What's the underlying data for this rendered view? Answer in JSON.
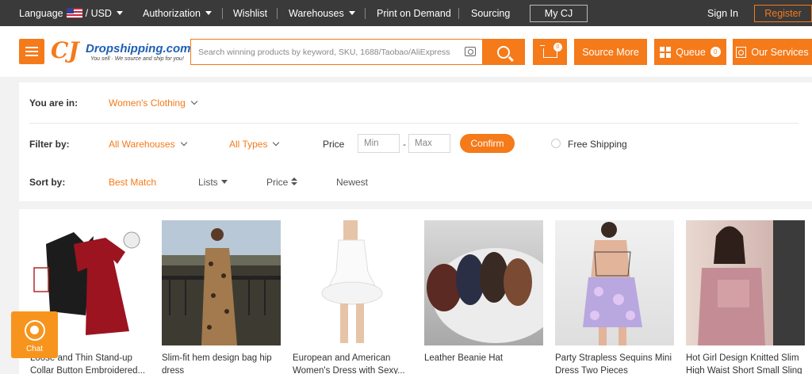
{
  "topbar": {
    "language_label": "Language",
    "currency": "/ USD",
    "authorization": "Authorization",
    "wishlist": "Wishlist",
    "warehouses": "Warehouses",
    "print_on_demand": "Print on Demand",
    "sourcing": "Sourcing",
    "my_cj": "My CJ",
    "sign_in": "Sign In",
    "register": "Register"
  },
  "header": {
    "logo_mark": "CJ",
    "logo_brand": "Dropshipping.com",
    "logo_tagline": "You sell · We source and ship for you!",
    "search_placeholder": "Search winning products by keyword, SKU, 1688/Taobao/AliExpress URL",
    "cart_count": "0",
    "source_more": "Source More",
    "queue_label": "Queue",
    "queue_count": "0",
    "our_services": "Our Services"
  },
  "filters": {
    "you_are_in_label": "You are in:",
    "category": "Women's Clothing",
    "filter_by_label": "Filter by:",
    "warehouses": "All Warehouses",
    "types": "All Types",
    "price_label": "Price",
    "min_placeholder": "Min",
    "price_dash": "-",
    "max_placeholder": "Max",
    "confirm": "Confirm",
    "free_shipping": "Free Shipping",
    "sort_by_label": "Sort by:",
    "sort_best_match": "Best Match",
    "sort_lists": "Lists",
    "sort_price": "Price",
    "sort_newest": "Newest"
  },
  "products": [
    {
      "title": "Loose and Thin Stand-up Collar Button Embroidered..."
    },
    {
      "title": "Slim-fit hem design bag hip dress"
    },
    {
      "title": "European and American Women's Dress with Sexy..."
    },
    {
      "title": "Leather Beanie Hat"
    },
    {
      "title": "Party Strapless Sequins Mini Dress Two Pieces"
    },
    {
      "title": "Hot Girl Design Knitted Slim High Waist Short Small Sling"
    }
  ],
  "chat": {
    "label": "Chat"
  },
  "colors": {
    "accent": "#f57a19",
    "topbar": "#3a3a3a"
  }
}
